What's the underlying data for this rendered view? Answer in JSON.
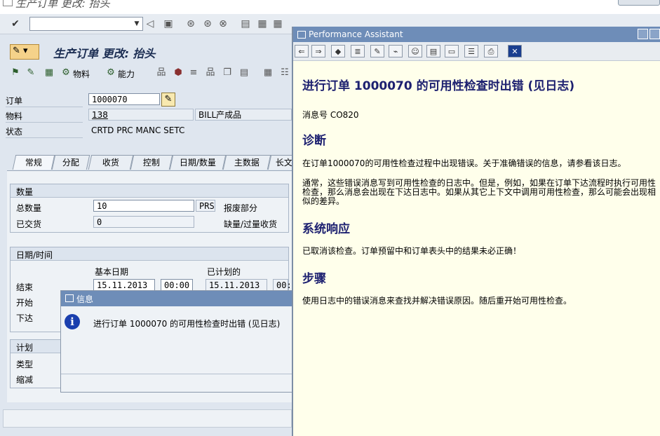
{
  "window_title": "生产订单 更改: 抬头",
  "page_title": "生产订单 更改: 抬头",
  "app_toolbar": {
    "material_btn": "物料",
    "capacity_btn": "能力"
  },
  "header": {
    "order_label": "订单",
    "order_value": "1000070",
    "material_label": "物料",
    "material_value": "138",
    "material_desc": "BILL产成品",
    "status_label": "状态",
    "status_value": "CRTD PRC  MANC SETC"
  },
  "tabs": [
    "常规",
    "分配",
    "收货",
    "控制",
    "日期/数量",
    "主数据",
    "长文"
  ],
  "quantity": {
    "group_title": "数量",
    "total_label": "总数量",
    "total_value": "10",
    "unit": "PRS",
    "scrap_label": "报废部分",
    "delivered_label": "已交货",
    "delivered_value": "0",
    "shortage_label": "缺量/过量收货"
  },
  "dates": {
    "group_title": "日期/时间",
    "basic_col": "基本日期",
    "scheduled_col": "已计划的",
    "end_label": "结束",
    "start_label": "开始",
    "release_label": "下达",
    "end_basic_date": "15.11.2013",
    "end_basic_time": "00:00",
    "end_sched_date": "15.11.2013",
    "end_sched_time": "00:"
  },
  "planning": {
    "group_title": "计划",
    "type_label": "类型",
    "reduction_label": "缩减"
  },
  "info_popup": {
    "title": "信息",
    "message": "进行订单 1000070 的可用性检查时出错 (见日志)"
  },
  "assistant": {
    "window_title": "Performance Assistant",
    "heading": "进行订单  1000070 的可用性检查时出错  (见日志)",
    "message_no": "消息号  CO820",
    "diag_title": "诊断",
    "diag_text": "在订单1000070的可用性检查过程中出现错误。关于准确错误的信息，请参看该日志。",
    "diag_text2": "通常，这些错误消息写到可用性检查的日志中。但是，例如，如果在订单下达流程时执行可用性检查，那么消息会出现在下达日志中。如果从其它上下文中调用可用性检查，那么可能会出现相似的差异。",
    "response_title": "系统响应",
    "response_text": "已取消该检查。订单预留中和订单表头中的结果未必正确！",
    "steps_title": "步骤",
    "steps_text": "使用日志中的错误消息来查找并解决错误原因。随后重开始可用性检查。"
  }
}
